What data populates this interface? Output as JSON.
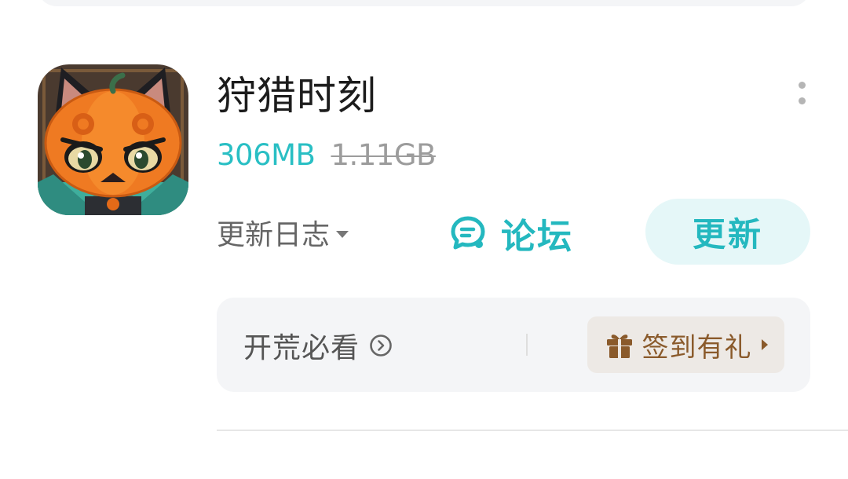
{
  "app": {
    "name": "狩猎时刻",
    "download_size": "306MB",
    "original_size": "1.11GB",
    "icon": "pumpkin-cat-game-icon"
  },
  "actions": {
    "changelog_label": "更新日志",
    "forum_label": "论坛",
    "update_label": "更新",
    "more_icon": "more-vertical-icon"
  },
  "promo": {
    "guide_label": "开荒必看",
    "checkin_label": "签到有礼"
  },
  "colors": {
    "accent": "#24b8bf",
    "accent_bg": "#e5f7f8",
    "size_text": "#29bfc4",
    "gift_brown": "#8a5a2b",
    "gift_bg": "#ede9e5",
    "panel_bg": "#f4f5f7"
  }
}
